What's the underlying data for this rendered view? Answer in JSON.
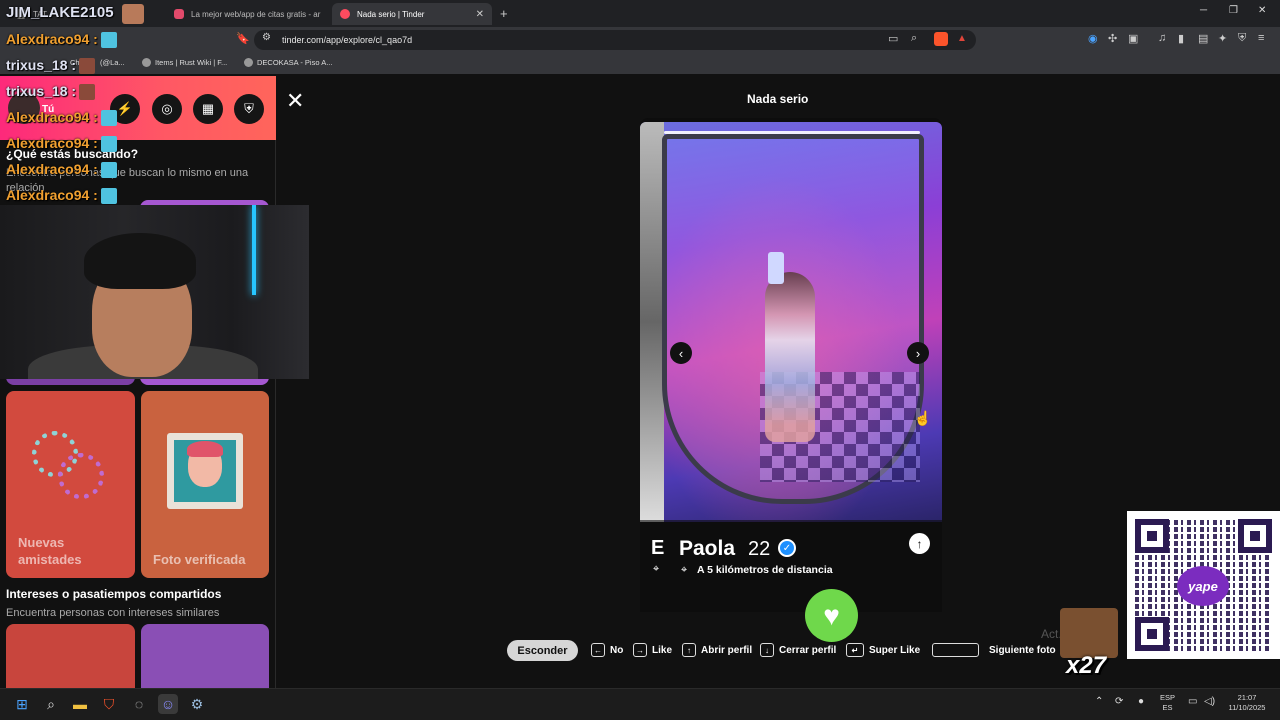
{
  "browser": {
    "tabs": [
      {
        "label": "TAT..."
      },
      {
        "label": "La mejor web/app de citas gratis - ar"
      },
      {
        "label": "Nada serio | Tinder"
      }
    ],
    "new_tab": "+",
    "url": "tinder.com/app/explore/cl_qao7d",
    "bookmarks": [
      {
        "label": "Ch"
      },
      {
        "label": "(@La..."
      },
      {
        "label": "Items | Rust Wiki | F..."
      },
      {
        "label": "DECOKASA - Piso A..."
      }
    ]
  },
  "sidebar": {
    "you_label": "Tú",
    "section1_title": "¿Qué estás buscando?",
    "section1_subtitle": "Encuentra personas que buscan lo mismo en una relación",
    "cards": [
      {
        "label": "Nuevas amistades",
        "color": "#d24a3e"
      },
      {
        "label": "Foto verificada",
        "color": "#c9623f"
      }
    ],
    "section2_title": "Intereses o pasatiempos compartidos",
    "section2_subtitle": "Encuentra personas con intereses similares",
    "section2_colors": [
      "#c8453d",
      "#8a4fb5"
    ]
  },
  "main": {
    "title": "Nada serio",
    "profile": {
      "initial": "E",
      "name": "Paola",
      "age": "22",
      "distance": "A 5 kilómetros de distancia"
    },
    "hints": {
      "hide": "Esconder",
      "no": "No",
      "like": "Like",
      "open_profile": "Abrir perfil",
      "close_profile": "Cerrar perfil",
      "super_like": "Super Like",
      "next_photo": "Siguiente foto"
    }
  },
  "stream": {
    "streamer": "JIM_LAKE2105",
    "chat": [
      {
        "user": "Alexdraco94",
        "sep": ":",
        "color": "#f0a030"
      },
      {
        "user": "trixus_18",
        "sep": ":",
        "color": "#dfe2f2"
      },
      {
        "user": "trixus_18",
        "sep": ":",
        "color": "#dfe2f2"
      },
      {
        "user": "Alexdraco94",
        "sep": ":",
        "color": "#f0a030"
      },
      {
        "user": "Alexdraco94",
        "sep": ":",
        "color": "#f0a030"
      },
      {
        "user": "Alexdraco94",
        "sep": ":",
        "color": "#f0a030"
      },
      {
        "user": "Alexdraco94",
        "sep": ":",
        "color": "#f0a030"
      }
    ],
    "emote_counter": "x27",
    "qr_brand": "yape",
    "faded_text": "Act..."
  },
  "taskbar": {
    "lang_top": "ESP",
    "lang_bottom": "ES",
    "time": "21:07",
    "date": "11/10/2025"
  },
  "colors": {
    "tinder_gradient_start": "#fd297b",
    "tinder_gradient_end": "#ff655b",
    "like_green": "#6fd84b",
    "verified_blue": "#1e90ff"
  }
}
